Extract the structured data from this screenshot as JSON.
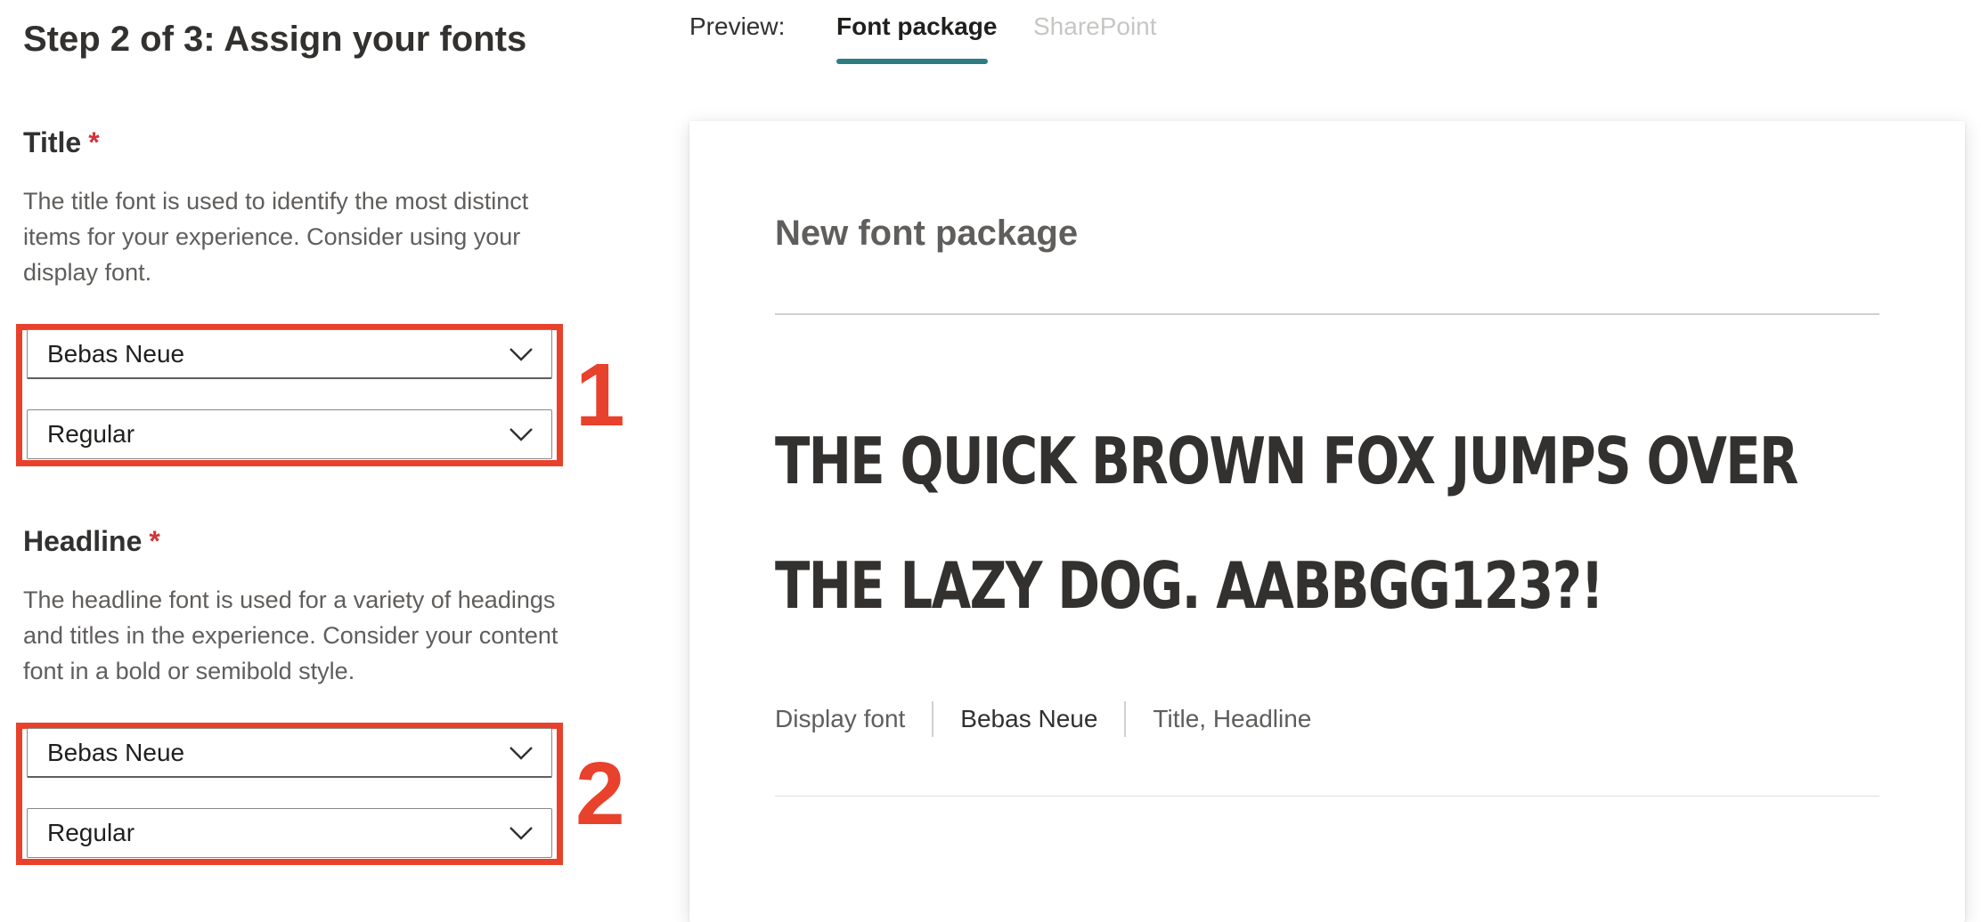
{
  "header": {
    "step_title": "Step 2 of 3: Assign your fonts"
  },
  "sections": {
    "title": {
      "label": "Title",
      "required_mark": "*",
      "description": "The title font is used to identify the most distinct items for your experience. Consider using your display font.",
      "font_family": "Bebas Neue",
      "font_style": "Regular",
      "callout_number": "1"
    },
    "headline": {
      "label": "Headline",
      "required_mark": "*",
      "description": "The headline font is used for a variety of headings and titles in the experience. Consider your content font in a bold or semibold style.",
      "font_family": "Bebas Neue",
      "font_style": "Regular",
      "callout_number": "2"
    }
  },
  "preview": {
    "label": "Preview:",
    "tabs": [
      {
        "label": "Font package",
        "active": true
      },
      {
        "label": "SharePoint",
        "active": false
      }
    ],
    "card": {
      "title": "New font package",
      "sample_text": "THE QUICK BROWN FOX JUMPS OVER THE LAZY DOG. AABBGG123?!",
      "meta": {
        "font_role": "Display font",
        "font_name": "Bebas Neue",
        "used_for": "Title, Headline"
      }
    }
  },
  "colors": {
    "highlight": "#e8412c",
    "tab_accent": "#2e7d82",
    "required": "#d13438"
  },
  "icons": {
    "dropdown": "chevron-down-icon"
  }
}
